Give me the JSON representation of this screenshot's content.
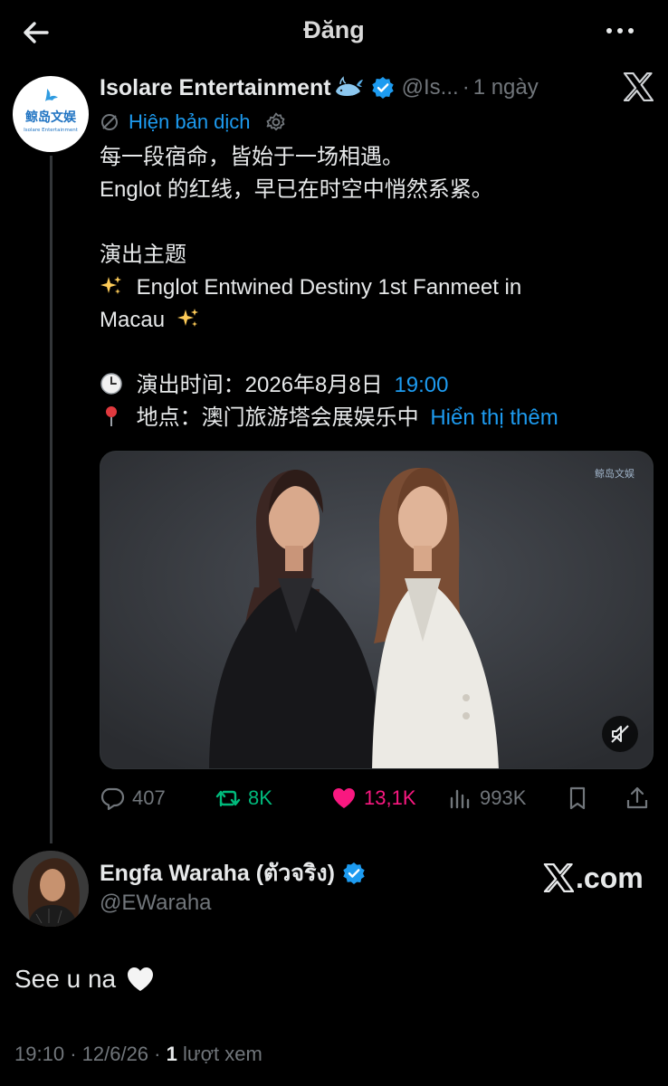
{
  "topbar": {
    "title": "Đăng"
  },
  "post": {
    "author_name": "Isolare Entertainment",
    "author_handle": "@Is...",
    "separator": "·",
    "time": "1 ngày",
    "translate_label": "Hiện bản dịch",
    "avatar_text_cn": "鲸岛文娱",
    "avatar_text_en": "Isolare Entertainment",
    "lines": {
      "l1": "每一段宿命，皆始于一场相遇。",
      "l2": "Englot 的红线，早已在时空中悄然系紧。",
      "l3": "演出主题",
      "l4": "Englot Entwined Destiny 1st Fanmeet in",
      "l5": "Macau",
      "l6_prefix": "演出时间：2026年8月8日",
      "l6_link": "19:00",
      "l7_prefix": "地点：澳门旅游塔会展娱乐中",
      "l7_link": "Hiển thị thêm"
    },
    "media_watermark": "鲸岛文娱",
    "stats": {
      "replies": "407",
      "reposts": "8K",
      "likes": "13,1K",
      "views": "993K"
    }
  },
  "reply": {
    "author_name": "Engfa Waraha (ตัวจริง)",
    "author_handle": "@EWaraha",
    "text": "See u na",
    "brand": ".com"
  },
  "footer": {
    "time": "19:10",
    "sep1": "·",
    "date": "12/6/26",
    "sep2": "·",
    "view_count": "1",
    "view_label": "lượt xem"
  },
  "colors": {
    "accent": "#1d9bf0",
    "repost": "#00ba7c",
    "like": "#f91880",
    "muted": "#71767b",
    "background": "#000000"
  },
  "icons": [
    "back-arrow-icon",
    "more-icon",
    "x-logo-icon",
    "verified-badge-icon",
    "translate-icon",
    "gear-icon",
    "sparkles-icon",
    "clock-icon",
    "pin-icon",
    "mute-icon",
    "reply-icon",
    "repost-icon",
    "heart-icon",
    "views-icon",
    "bookmark-icon",
    "share-icon",
    "white-heart-icon"
  ]
}
